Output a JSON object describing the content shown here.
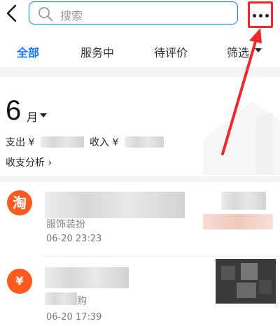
{
  "search": {
    "placeholder": "搜索"
  },
  "tabs": [
    {
      "label": "全部",
      "active": true
    },
    {
      "label": "服务中",
      "active": false
    },
    {
      "label": "待评价",
      "active": false
    },
    {
      "label": "筛选",
      "active": false
    }
  ],
  "summary": {
    "month_number": "6",
    "month_unit": "月",
    "expense_label": "支出 ¥",
    "income_label": "收入 ¥",
    "analysis_label": "收支分析 ›"
  },
  "transactions": [
    {
      "icon_text": "淘",
      "subtitle": "服饰装扮",
      "time": "06-20  23:23"
    },
    {
      "icon_text": "¥",
      "subtitle": "购",
      "time": "06-20  17:39"
    }
  ],
  "colors": {
    "accent": "#1677ff",
    "highlight": "#f0282d",
    "icon_orange": "#ff5a1f"
  }
}
